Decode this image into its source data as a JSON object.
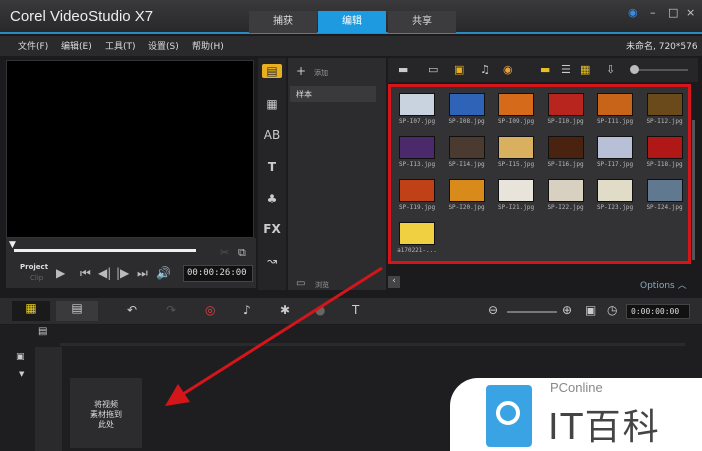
{
  "app_title": "Corel VideoStudio X7",
  "tabs": [
    {
      "label": "捕获"
    },
    {
      "label": "编辑",
      "active": true
    },
    {
      "label": "共享"
    }
  ],
  "window_controls": {
    "minimize": "–",
    "maximize": "□",
    "close": "×"
  },
  "menu": [
    "文件(F)",
    "编辑(E)",
    "工具(T)",
    "设置(S)",
    "帮助(H)"
  ],
  "project_info": "未命名, 720*576",
  "player": {
    "project_label": "Project",
    "clip_label": "Clip",
    "timecode": "00:00:26:00"
  },
  "library": {
    "add_label": "添加",
    "folder": "样本",
    "browse_label": "浏览"
  },
  "thumbnails": [
    {
      "name": "SP-I07.jpg",
      "color": "#c9d3e0"
    },
    {
      "name": "SP-I08.jpg",
      "color": "#2f63b8"
    },
    {
      "name": "SP-I09.jpg",
      "color": "#d56a1a"
    },
    {
      "name": "SP-I10.jpg",
      "color": "#b8241e"
    },
    {
      "name": "SP-I11.jpg",
      "color": "#c8631a"
    },
    {
      "name": "SP-I12.jpg",
      "color": "#6a4a1a"
    },
    {
      "name": "SP-I13.jpg",
      "color": "#4a2a6a"
    },
    {
      "name": "SP-I14.jpg",
      "color": "#4a3a30"
    },
    {
      "name": "SP-I15.jpg",
      "color": "#d8b060"
    },
    {
      "name": "SP-I16.jpg",
      "color": "#4a2210"
    },
    {
      "name": "SP-I17.jpg",
      "color": "#b8c0d8"
    },
    {
      "name": "SP-I18.jpg",
      "color": "#b01818"
    },
    {
      "name": "SP-I19.jpg",
      "color": "#c04018"
    },
    {
      "name": "SP-I20.jpg",
      "color": "#d88a1a"
    },
    {
      "name": "SP-I21.jpg",
      "color": "#e8e4dc"
    },
    {
      "name": "SP-I22.jpg",
      "color": "#d8d0c0"
    },
    {
      "name": "SP-I23.jpg",
      "color": "#e0dcc8"
    },
    {
      "name": "SP-I24.jpg",
      "color": "#607890"
    },
    {
      "name": "a170221-...",
      "color": "#f0d040"
    }
  ],
  "options_label": "Options",
  "timeline_timecode": "0:00:00:00",
  "dropbox_text": "将视频\n素材拖到\n此处",
  "watermark": {
    "brand": "PConline",
    "name": "IT百科"
  },
  "colors": {
    "accent": "#1e9be0",
    "highlight": "#d4161b"
  }
}
